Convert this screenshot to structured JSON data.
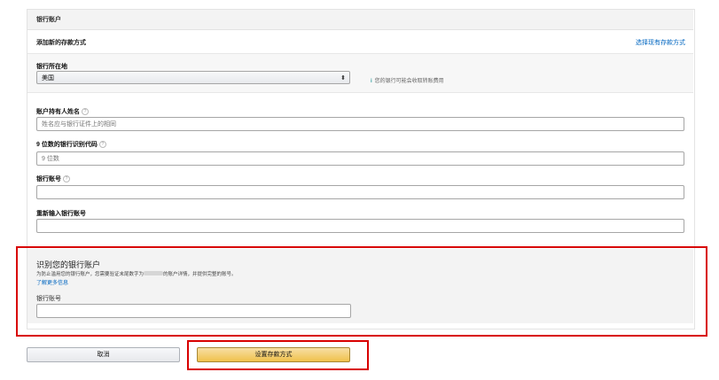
{
  "panel": {
    "title": "银行账户",
    "subtitle": "添加新的存款方式",
    "choose_existing_link": "选择现有存款方式"
  },
  "region": {
    "label": "银行所在地",
    "selected": "美国",
    "hint": "您的银行可能会收取转账费用"
  },
  "fields": {
    "holder_label": "账户持有人姓名",
    "holder_placeholder": "姓名应与银行证件上的相同",
    "routing_label": "9 位数的银行识别代码",
    "routing_placeholder": "9 位数",
    "account_label": "银行账号",
    "account_placeholder": "",
    "reenter_label": "重新输入银行账号",
    "reenter_placeholder": ""
  },
  "verify": {
    "title": "识别您的银行账户",
    "desc_before": "为防止滥用您的银行账户，您需要验证末尾数字为",
    "desc_after": "的账户详情，并提供完整的账号。",
    "learn_more": "了解更多信息",
    "account_label": "银行账号",
    "account_placeholder": ""
  },
  "buttons": {
    "cancel": "取消",
    "submit": "设置存款方式"
  },
  "colors": {
    "link": "#0066c0",
    "highlight": "#d80000",
    "primary_button": "#f0c14b"
  },
  "icons": {
    "help": "help-circle-icon",
    "info": "info-icon",
    "select_arrow": "up-down-arrow-icon"
  }
}
